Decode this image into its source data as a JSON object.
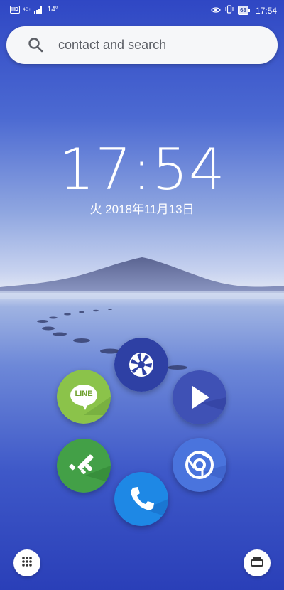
{
  "status_bar": {
    "hd_badge": "HD",
    "network_type": "4G+",
    "temperature": "14°",
    "battery_level": "68",
    "time": "17:54"
  },
  "search": {
    "placeholder": "contact and search"
  },
  "clock": {
    "time": "17:54",
    "date": "火 2018年11月13日"
  },
  "apps": [
    {
      "name": "Camera",
      "icon": "camera-aperture-icon",
      "color": "#2e40a4"
    },
    {
      "name": "LINE",
      "icon": "line-logo-icon",
      "label": "LINE",
      "color": "#8bc34a"
    },
    {
      "name": "Play Store",
      "icon": "play-icon",
      "color": "#3f51b5"
    },
    {
      "name": "Feedly",
      "icon": "feedly-icon",
      "color": "#43a047"
    },
    {
      "name": "Chrome",
      "icon": "chrome-icon",
      "color": "#4a74dd"
    },
    {
      "name": "Phone",
      "icon": "phone-icon",
      "color": "#1e88e5"
    }
  ],
  "dock": {
    "left_icon": "apps-grid-icon",
    "right_icon": "recent-apps-icon"
  }
}
